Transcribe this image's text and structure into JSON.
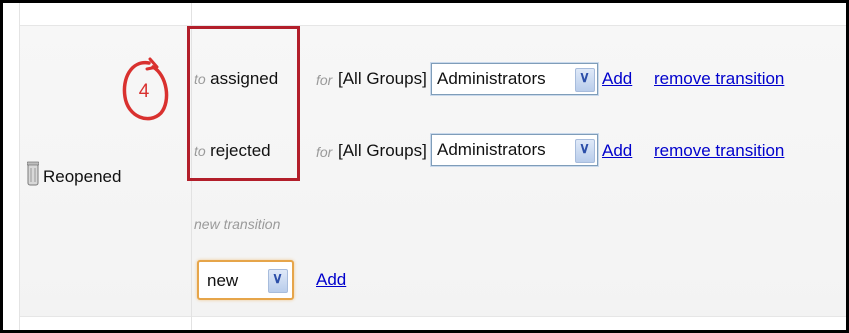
{
  "state": {
    "label": "Reopened",
    "step_number": "4"
  },
  "transitions": [
    {
      "to_word": "to",
      "target": "assigned",
      "for_word": "for",
      "groups_label": "[All Groups]",
      "group_select": "Administrators",
      "add_label": "Add",
      "remove_label": "remove transition"
    },
    {
      "to_word": "to",
      "target": "rejected",
      "for_word": "for",
      "groups_label": "[All Groups]",
      "group_select": "Administrators",
      "add_label": "Add",
      "remove_label": "remove transition"
    }
  ],
  "new_transition": {
    "label": "new transition",
    "select_value": "new",
    "add_label": "Add"
  },
  "colors": {
    "highlight": "#b21e2a",
    "link": "#0000cc",
    "step_circle": "#d9312f"
  }
}
